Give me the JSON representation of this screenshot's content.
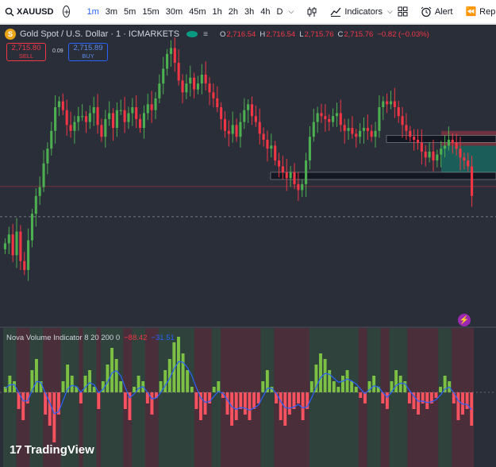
{
  "toolbar": {
    "symbol": "XAUUSD",
    "timeframes": [
      "1m",
      "3m",
      "5m",
      "15m",
      "30m",
      "45m",
      "1h",
      "2h",
      "3h",
      "4h",
      "D"
    ],
    "active_timeframe": "1m",
    "indicators_label": "Indicators",
    "alert_label": "Alert",
    "replay_label": "Rep"
  },
  "legend": {
    "title": "Gold Spot / U.S. Dollar · 1 · ICMARKETS",
    "coin_glyph": "S",
    "open_key": "O",
    "open": "2,716.54",
    "high_key": "H",
    "high": "2,716.54",
    "low_key": "L",
    "low": "2,715.76",
    "close_key": "C",
    "close": "2,715.76",
    "change": "−0.82 (−0.03%)"
  },
  "trade": {
    "sell_price": "2,715.80",
    "sell_label": "SELL",
    "spread": "0.09",
    "buy_price": "2,715.89",
    "buy_label": "BUY"
  },
  "indicator": {
    "name": "Nova Volume Indicator 8 20 200 0",
    "value1": "−88.42",
    "value2": "−31.51"
  },
  "brand": {
    "name": "TradingView"
  },
  "colors": {
    "bull": "#089981",
    "bull_candle": "#4caf50",
    "bear": "#f23645",
    "accent": "#2962ff",
    "background": "#2a2e39"
  },
  "chart_data": {
    "type": "candlestick",
    "price_path": [
      2714.2,
      2714.5,
      2713.8,
      2714.6,
      2713.6,
      2713.3,
      2714.3,
      2715.2,
      2715.8,
      2716.1,
      2716.9,
      2717.4,
      2718.0,
      2718.8,
      2719.0,
      2718.7,
      2718.2,
      2718.0,
      2718.3,
      2718.5,
      2718.5,
      2718.3,
      2718.6,
      2718.8,
      2718.2,
      2717.8,
      2718.4,
      2718.6,
      2718.1,
      2718.7,
      2718.7,
      2718.3,
      2718.6,
      2718.8,
      2718.4,
      2718.1,
      2718.6,
      2718.9,
      2718.7,
      2719.1,
      2719.6,
      2720.1,
      2720.6,
      2720.8,
      2720.3,
      2719.7,
      2719.3,
      2719.6,
      2719.8,
      2719.4,
      2719.6,
      2719.9,
      2719.6,
      2719.3,
      2719.1,
      2718.8,
      2718.4,
      2718.0,
      2717.9,
      2718.2,
      2717.8,
      2718.3,
      2718.7,
      2718.9,
      2718.5,
      2718.3,
      2717.9,
      2717.7,
      2717.4,
      2717.5,
      2717.0,
      2716.8,
      2716.6,
      2716.4,
      2716.6,
      2716.2,
      2716.0,
      2716.2,
      2717.0,
      2717.8,
      2718.3,
      2718.6,
      2718.5,
      2718.4,
      2718.3,
      2718.5,
      2718.6,
      2718.2,
      2718.0,
      2718.1,
      2717.9,
      2717.8,
      2718.0,
      2718.1,
      2718.0,
      2717.8,
      2718.0,
      2718.8,
      2719.0,
      2718.9,
      2719.0,
      2718.8,
      2718.5,
      2718.2,
      2718.0,
      2717.8,
      2717.7,
      2717.6,
      2717.3,
      2717.1,
      2717.3,
      2717.0,
      2717.2,
      2717.4,
      2717.5,
      2717.7,
      2717.6,
      2717.4,
      2717.1,
      2717.0,
      2716.8,
      2715.8
    ],
    "price_ylim": [
      2711.5,
      2721.0
    ],
    "reference_level": 2715.1,
    "zones": [
      {
        "kind": "resistance",
        "low": 2717.7,
        "high": 2717.85
      },
      {
        "kind": "support",
        "low": 2716.45,
        "high": 2716.6
      }
    ],
    "trade_box": {
      "entry": 2717.5,
      "target": 2716.6,
      "stop": 2718.0
    },
    "indicator_values": [
      0.1,
      0.3,
      0.2,
      -0.3,
      -0.5,
      -0.2,
      0.4,
      0.6,
      0.2,
      -0.4,
      -0.6,
      -0.9,
      -0.4,
      0.2,
      0.5,
      0.3,
      0.1,
      -0.2,
      0.3,
      0.4,
      0.1,
      -0.3,
      0.2,
      0.5,
      0.8,
      0.6,
      0.2,
      -0.3,
      -0.5,
      0.1,
      0.3,
      0.2,
      -0.2,
      -0.4,
      -0.1,
      0.2,
      0.4,
      0.6,
      0.9,
      1.0,
      0.7,
      0.4,
      0.1,
      -0.3,
      -0.5,
      -0.4,
      -0.2,
      0.1,
      0.2,
      -0.1,
      -0.4,
      -0.6,
      -0.5,
      -0.3,
      -0.4,
      -0.5,
      -0.3,
      -0.2,
      0.2,
      0.4,
      0.1,
      -0.2,
      -0.5,
      -0.6,
      -0.4,
      -0.3,
      -0.2,
      -0.5,
      -0.3,
      0.2,
      0.5,
      0.7,
      0.6,
      0.4,
      0.2,
      0.1,
      0.3,
      0.4,
      0.2,
      0.1,
      -0.1,
      -0.2,
      0.2,
      0.3,
      0.1,
      -0.2,
      -0.3,
      0.2,
      0.4,
      0.3,
      0.2,
      -0.2,
      -0.3,
      -0.4,
      -0.2,
      -0.3,
      -0.2,
      -0.1,
      0.1,
      0.3,
      0.2,
      -0.2,
      -0.5,
      -0.4,
      -0.3,
      -0.6
    ]
  }
}
